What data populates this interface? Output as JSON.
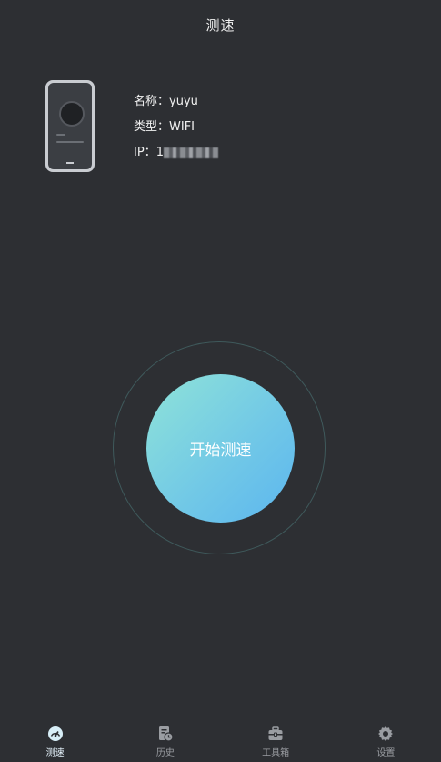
{
  "header": {
    "title": "测速"
  },
  "device": {
    "name_label": "名称：",
    "name_value": "yuyu",
    "type_label": "类型：",
    "type_value": "WIFI",
    "ip_label": "IP：",
    "ip_prefix": "1"
  },
  "main": {
    "start_button_label": "开始测速"
  },
  "tabbar": {
    "items": [
      {
        "label": "测速",
        "icon": "speedometer-icon",
        "active": true
      },
      {
        "label": "历史",
        "icon": "history-icon",
        "active": false
      },
      {
        "label": "工具箱",
        "icon": "toolbox-icon",
        "active": false
      },
      {
        "label": "设置",
        "icon": "gear-icon",
        "active": false
      }
    ]
  },
  "colors": {
    "background": "#2d2f33",
    "accent_start": "#8fe3d8",
    "accent_end": "#5cb6ef",
    "active_tab_icon": "#d7eef7",
    "inactive_tab_icon": "#9a9da2"
  }
}
